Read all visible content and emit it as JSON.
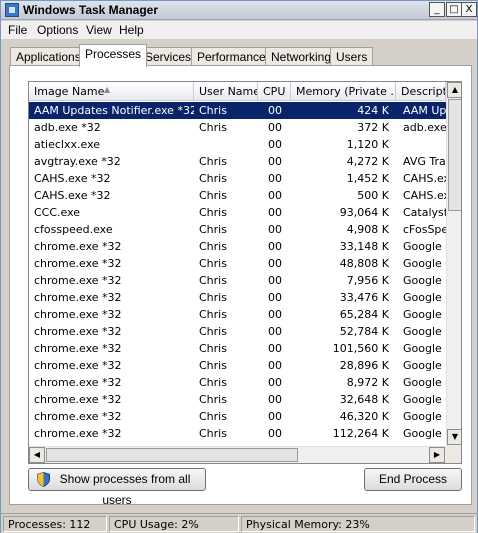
{
  "window": {
    "title": "Windows Task Manager"
  },
  "window_controls": {
    "minimize": "_",
    "maximize": "□",
    "close": "X"
  },
  "menu": [
    "File",
    "Options",
    "View",
    "Help"
  ],
  "tabs": [
    "Applications",
    "Processes",
    "Services",
    "Performance",
    "Networking",
    "Users"
  ],
  "active_tab": "Processes",
  "columns": [
    "Image Name",
    "User Name",
    "CPU",
    "Memory (Private ...",
    "Descriptio"
  ],
  "sort_arrow": "▲",
  "rows": [
    {
      "name": "AAM Updates Notifier.exe *32",
      "user": "Chris",
      "cpu": "00",
      "mem": "424 K",
      "desc": "AAM Upd"
    },
    {
      "name": "adb.exe *32",
      "user": "Chris",
      "cpu": "00",
      "mem": "372 K",
      "desc": "adb.exe"
    },
    {
      "name": "atieclxx.exe",
      "user": "",
      "cpu": "00",
      "mem": "1,120 K",
      "desc": ""
    },
    {
      "name": "avgtray.exe *32",
      "user": "Chris",
      "cpu": "00",
      "mem": "4,272 K",
      "desc": "AVG Tray"
    },
    {
      "name": "CAHS.exe *32",
      "user": "Chris",
      "cpu": "00",
      "mem": "1,452 K",
      "desc": "CAHS.exe"
    },
    {
      "name": "CAHS.exe *32",
      "user": "Chris",
      "cpu": "00",
      "mem": "500 K",
      "desc": "CAHS.exe"
    },
    {
      "name": "CCC.exe",
      "user": "Chris",
      "cpu": "00",
      "mem": "93,064 K",
      "desc": "Catalyst"
    },
    {
      "name": "cfosspeed.exe",
      "user": "Chris",
      "cpu": "00",
      "mem": "4,908 K",
      "desc": "cFosSpee"
    },
    {
      "name": "chrome.exe *32",
      "user": "Chris",
      "cpu": "00",
      "mem": "33,148 K",
      "desc": "Google C"
    },
    {
      "name": "chrome.exe *32",
      "user": "Chris",
      "cpu": "00",
      "mem": "48,808 K",
      "desc": "Google C"
    },
    {
      "name": "chrome.exe *32",
      "user": "Chris",
      "cpu": "00",
      "mem": "7,956 K",
      "desc": "Google C"
    },
    {
      "name": "chrome.exe *32",
      "user": "Chris",
      "cpu": "00",
      "mem": "33,476 K",
      "desc": "Google C"
    },
    {
      "name": "chrome.exe *32",
      "user": "Chris",
      "cpu": "00",
      "mem": "65,284 K",
      "desc": "Google C"
    },
    {
      "name": "chrome.exe *32",
      "user": "Chris",
      "cpu": "00",
      "mem": "52,784 K",
      "desc": "Google C"
    },
    {
      "name": "chrome.exe *32",
      "user": "Chris",
      "cpu": "00",
      "mem": "101,560 K",
      "desc": "Google C"
    },
    {
      "name": "chrome.exe *32",
      "user": "Chris",
      "cpu": "00",
      "mem": "28,896 K",
      "desc": "Google C"
    },
    {
      "name": "chrome.exe *32",
      "user": "Chris",
      "cpu": "00",
      "mem": "8,972 K",
      "desc": "Google C"
    },
    {
      "name": "chrome.exe *32",
      "user": "Chris",
      "cpu": "00",
      "mem": "32,648 K",
      "desc": "Google C"
    },
    {
      "name": "chrome.exe *32",
      "user": "Chris",
      "cpu": "00",
      "mem": "46,320 K",
      "desc": "Google C"
    },
    {
      "name": "chrome.exe *32",
      "user": "Chris",
      "cpu": "00",
      "mem": "112,264 K",
      "desc": "Google C"
    }
  ],
  "buttons": {
    "show_all": "Show processes from all users",
    "end_process": "End Process"
  },
  "status": {
    "processes": "Processes: 112",
    "cpu": "CPU Usage: 2%",
    "memory": "Physical Memory: 23%"
  },
  "colors": {
    "selection": "#0a246a",
    "window_bg": "#d4d0c8"
  }
}
